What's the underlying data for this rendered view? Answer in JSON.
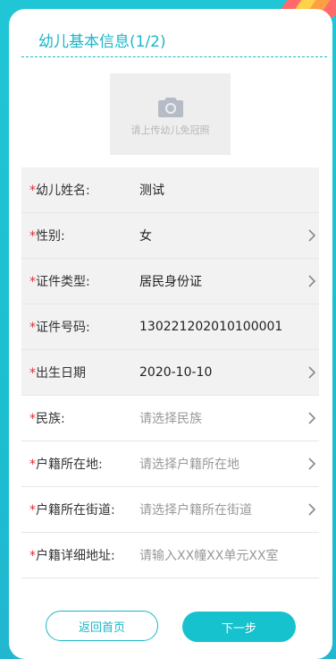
{
  "colors": {
    "accent": "#1ab7c7",
    "required": "#e02f2f",
    "button_primary": "#17c2cf"
  },
  "header": {
    "title": "幼儿基本信息(1/2)"
  },
  "photo": {
    "hint": "请上传幼儿免冠照",
    "icon": "camera-icon"
  },
  "form": {
    "fields": [
      {
        "label": "幼儿姓名:",
        "value": "测试",
        "placeholder": false,
        "chevron": false
      },
      {
        "label": "性别:",
        "value": "女",
        "placeholder": false,
        "chevron": true
      },
      {
        "label": "证件类型:",
        "value": "居民身份证",
        "placeholder": false,
        "chevron": true
      },
      {
        "label": "证件号码:",
        "value": "130221202010100001",
        "placeholder": false,
        "chevron": false
      },
      {
        "label": "出生日期",
        "value": "2020-10-10",
        "placeholder": false,
        "chevron": true
      },
      {
        "label": "民族:",
        "value": "请选择民族",
        "placeholder": true,
        "chevron": true
      },
      {
        "label": "户籍所在地:",
        "value": "请选择户籍所在地",
        "placeholder": true,
        "chevron": true
      },
      {
        "label": "户籍所在街道:",
        "value": "请选择户籍所在街道",
        "placeholder": true,
        "chevron": true
      },
      {
        "label": "户籍详细地址:",
        "value": "请输入XX幢XX单元XX室",
        "placeholder": true,
        "chevron": false
      }
    ]
  },
  "buttons": {
    "back_label": "返回首页",
    "next_label": "下一步"
  }
}
